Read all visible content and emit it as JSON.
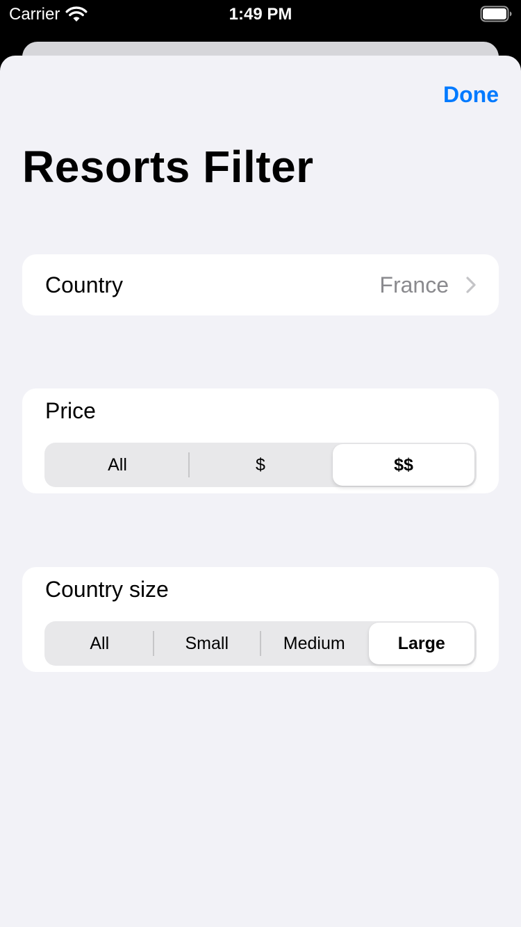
{
  "status_bar": {
    "carrier": "Carrier",
    "time": "1:49 PM",
    "icons": [
      "wifi-icon",
      "battery-icon"
    ]
  },
  "nav": {
    "done_label": "Done",
    "accent_color": "#007aff"
  },
  "title": "Resorts Filter",
  "country_row": {
    "label": "Country",
    "value": "France",
    "icon": "chevron-right-icon"
  },
  "price": {
    "label": "Price",
    "segments": [
      "All",
      "$",
      "$$"
    ],
    "selected": "$$"
  },
  "country_size": {
    "label": "Country size",
    "segments": [
      "All",
      "Small",
      "Medium",
      "Large"
    ],
    "selected": "Large"
  }
}
